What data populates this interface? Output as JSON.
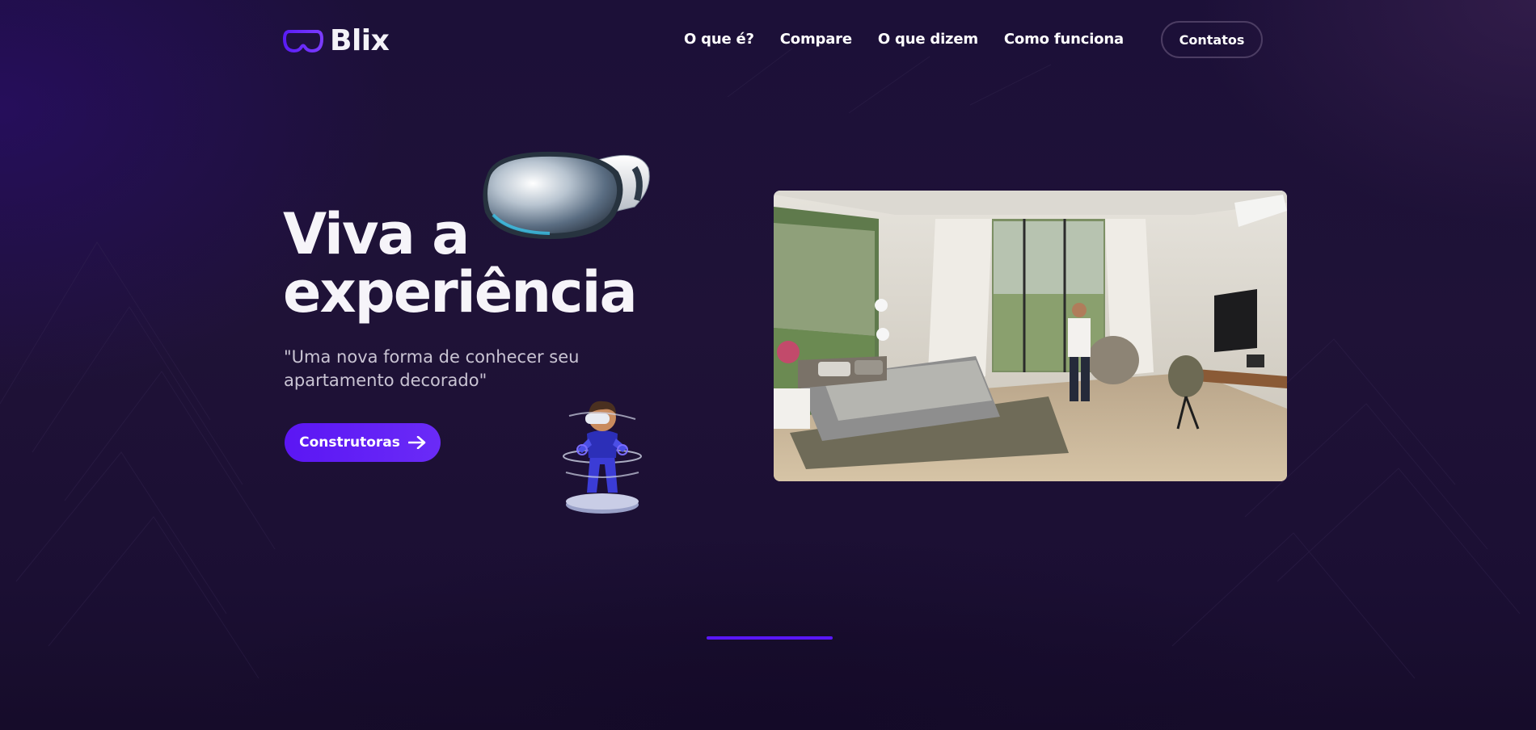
{
  "header": {
    "logo_text": "Blix",
    "nav": [
      "O que é?",
      "Compare",
      "O que dizem",
      "Como funciona"
    ],
    "contact_label": "Contatos"
  },
  "hero": {
    "title_line1": "Viva a",
    "title_line2": "experiência",
    "subtitle_line1": "\"Uma nova forma de conhecer seu",
    "subtitle_line2": "apartamento decorado\"",
    "cta_label": "Construtoras"
  },
  "media": {
    "goggles": "vr-headset-illustration",
    "figure": "vr-avatar-figure",
    "photo": "vr-bedroom-walkthrough-photo"
  },
  "colors": {
    "accent": "#5b16f4",
    "background": "#1c1038",
    "text": "#ffffff",
    "muted": "#c9c4d3"
  },
  "slider": {
    "active_index": 0
  }
}
